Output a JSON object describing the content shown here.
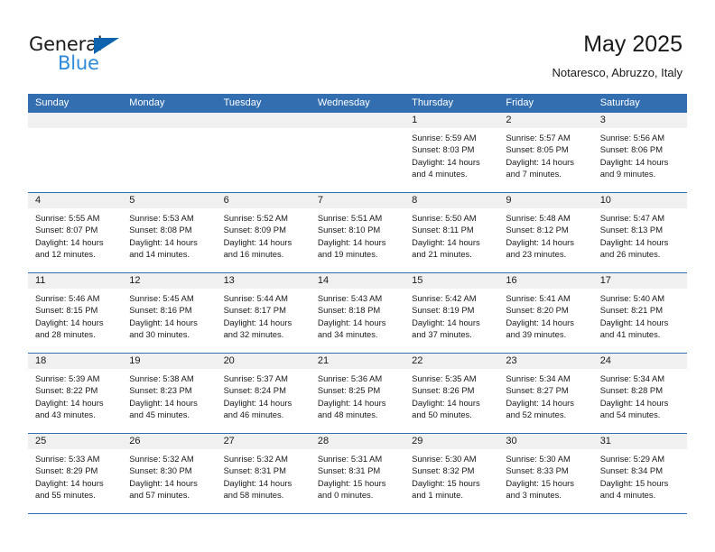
{
  "brand": {
    "name_top": "General",
    "name_bottom": "Blue",
    "triangle_icon": "triangle-icon",
    "color_dark": "#1a1a1a",
    "color_blue": "#2e8ada",
    "triangle_color": "#0d63ae"
  },
  "header": {
    "title": "May 2025",
    "subtitle": "Notaresco, Abruzzo, Italy"
  },
  "theme": {
    "header_bar": "#336fb0",
    "day_band": "#f0f0f0",
    "week_separator": "#336fb0",
    "text": "#1a1a1a"
  },
  "weekdays": [
    "Sunday",
    "Monday",
    "Tuesday",
    "Wednesday",
    "Thursday",
    "Friday",
    "Saturday"
  ],
  "weeks": [
    [
      {
        "day": "",
        "empty": true,
        "sunrise": "",
        "sunset": "",
        "daylight1": "",
        "daylight2": ""
      },
      {
        "day": "",
        "empty": true,
        "sunrise": "",
        "sunset": "",
        "daylight1": "",
        "daylight2": ""
      },
      {
        "day": "",
        "empty": true,
        "sunrise": "",
        "sunset": "",
        "daylight1": "",
        "daylight2": ""
      },
      {
        "day": "",
        "empty": true,
        "sunrise": "",
        "sunset": "",
        "daylight1": "",
        "daylight2": ""
      },
      {
        "day": "1",
        "sunrise": "Sunrise: 5:59 AM",
        "sunset": "Sunset: 8:03 PM",
        "daylight1": "Daylight: 14 hours",
        "daylight2": "and 4 minutes."
      },
      {
        "day": "2",
        "sunrise": "Sunrise: 5:57 AM",
        "sunset": "Sunset: 8:05 PM",
        "daylight1": "Daylight: 14 hours",
        "daylight2": "and 7 minutes."
      },
      {
        "day": "3",
        "sunrise": "Sunrise: 5:56 AM",
        "sunset": "Sunset: 8:06 PM",
        "daylight1": "Daylight: 14 hours",
        "daylight2": "and 9 minutes."
      }
    ],
    [
      {
        "day": "4",
        "sunrise": "Sunrise: 5:55 AM",
        "sunset": "Sunset: 8:07 PM",
        "daylight1": "Daylight: 14 hours",
        "daylight2": "and 12 minutes."
      },
      {
        "day": "5",
        "sunrise": "Sunrise: 5:53 AM",
        "sunset": "Sunset: 8:08 PM",
        "daylight1": "Daylight: 14 hours",
        "daylight2": "and 14 minutes."
      },
      {
        "day": "6",
        "sunrise": "Sunrise: 5:52 AM",
        "sunset": "Sunset: 8:09 PM",
        "daylight1": "Daylight: 14 hours",
        "daylight2": "and 16 minutes."
      },
      {
        "day": "7",
        "sunrise": "Sunrise: 5:51 AM",
        "sunset": "Sunset: 8:10 PM",
        "daylight1": "Daylight: 14 hours",
        "daylight2": "and 19 minutes."
      },
      {
        "day": "8",
        "sunrise": "Sunrise: 5:50 AM",
        "sunset": "Sunset: 8:11 PM",
        "daylight1": "Daylight: 14 hours",
        "daylight2": "and 21 minutes."
      },
      {
        "day": "9",
        "sunrise": "Sunrise: 5:48 AM",
        "sunset": "Sunset: 8:12 PM",
        "daylight1": "Daylight: 14 hours",
        "daylight2": "and 23 minutes."
      },
      {
        "day": "10",
        "sunrise": "Sunrise: 5:47 AM",
        "sunset": "Sunset: 8:13 PM",
        "daylight1": "Daylight: 14 hours",
        "daylight2": "and 26 minutes."
      }
    ],
    [
      {
        "day": "11",
        "sunrise": "Sunrise: 5:46 AM",
        "sunset": "Sunset: 8:15 PM",
        "daylight1": "Daylight: 14 hours",
        "daylight2": "and 28 minutes."
      },
      {
        "day": "12",
        "sunrise": "Sunrise: 5:45 AM",
        "sunset": "Sunset: 8:16 PM",
        "daylight1": "Daylight: 14 hours",
        "daylight2": "and 30 minutes."
      },
      {
        "day": "13",
        "sunrise": "Sunrise: 5:44 AM",
        "sunset": "Sunset: 8:17 PM",
        "daylight1": "Daylight: 14 hours",
        "daylight2": "and 32 minutes."
      },
      {
        "day": "14",
        "sunrise": "Sunrise: 5:43 AM",
        "sunset": "Sunset: 8:18 PM",
        "daylight1": "Daylight: 14 hours",
        "daylight2": "and 34 minutes."
      },
      {
        "day": "15",
        "sunrise": "Sunrise: 5:42 AM",
        "sunset": "Sunset: 8:19 PM",
        "daylight1": "Daylight: 14 hours",
        "daylight2": "and 37 minutes."
      },
      {
        "day": "16",
        "sunrise": "Sunrise: 5:41 AM",
        "sunset": "Sunset: 8:20 PM",
        "daylight1": "Daylight: 14 hours",
        "daylight2": "and 39 minutes."
      },
      {
        "day": "17",
        "sunrise": "Sunrise: 5:40 AM",
        "sunset": "Sunset: 8:21 PM",
        "daylight1": "Daylight: 14 hours",
        "daylight2": "and 41 minutes."
      }
    ],
    [
      {
        "day": "18",
        "sunrise": "Sunrise: 5:39 AM",
        "sunset": "Sunset: 8:22 PM",
        "daylight1": "Daylight: 14 hours",
        "daylight2": "and 43 minutes."
      },
      {
        "day": "19",
        "sunrise": "Sunrise: 5:38 AM",
        "sunset": "Sunset: 8:23 PM",
        "daylight1": "Daylight: 14 hours",
        "daylight2": "and 45 minutes."
      },
      {
        "day": "20",
        "sunrise": "Sunrise: 5:37 AM",
        "sunset": "Sunset: 8:24 PM",
        "daylight1": "Daylight: 14 hours",
        "daylight2": "and 46 minutes."
      },
      {
        "day": "21",
        "sunrise": "Sunrise: 5:36 AM",
        "sunset": "Sunset: 8:25 PM",
        "daylight1": "Daylight: 14 hours",
        "daylight2": "and 48 minutes."
      },
      {
        "day": "22",
        "sunrise": "Sunrise: 5:35 AM",
        "sunset": "Sunset: 8:26 PM",
        "daylight1": "Daylight: 14 hours",
        "daylight2": "and 50 minutes."
      },
      {
        "day": "23",
        "sunrise": "Sunrise: 5:34 AM",
        "sunset": "Sunset: 8:27 PM",
        "daylight1": "Daylight: 14 hours",
        "daylight2": "and 52 minutes."
      },
      {
        "day": "24",
        "sunrise": "Sunrise: 5:34 AM",
        "sunset": "Sunset: 8:28 PM",
        "daylight1": "Daylight: 14 hours",
        "daylight2": "and 54 minutes."
      }
    ],
    [
      {
        "day": "25",
        "sunrise": "Sunrise: 5:33 AM",
        "sunset": "Sunset: 8:29 PM",
        "daylight1": "Daylight: 14 hours",
        "daylight2": "and 55 minutes."
      },
      {
        "day": "26",
        "sunrise": "Sunrise: 5:32 AM",
        "sunset": "Sunset: 8:30 PM",
        "daylight1": "Daylight: 14 hours",
        "daylight2": "and 57 minutes."
      },
      {
        "day": "27",
        "sunrise": "Sunrise: 5:32 AM",
        "sunset": "Sunset: 8:31 PM",
        "daylight1": "Daylight: 14 hours",
        "daylight2": "and 58 minutes."
      },
      {
        "day": "28",
        "sunrise": "Sunrise: 5:31 AM",
        "sunset": "Sunset: 8:31 PM",
        "daylight1": "Daylight: 15 hours",
        "daylight2": "and 0 minutes."
      },
      {
        "day": "29",
        "sunrise": "Sunrise: 5:30 AM",
        "sunset": "Sunset: 8:32 PM",
        "daylight1": "Daylight: 15 hours",
        "daylight2": "and 1 minute."
      },
      {
        "day": "30",
        "sunrise": "Sunrise: 5:30 AM",
        "sunset": "Sunset: 8:33 PM",
        "daylight1": "Daylight: 15 hours",
        "daylight2": "and 3 minutes."
      },
      {
        "day": "31",
        "sunrise": "Sunrise: 5:29 AM",
        "sunset": "Sunset: 8:34 PM",
        "daylight1": "Daylight: 15 hours",
        "daylight2": "and 4 minutes."
      }
    ]
  ]
}
